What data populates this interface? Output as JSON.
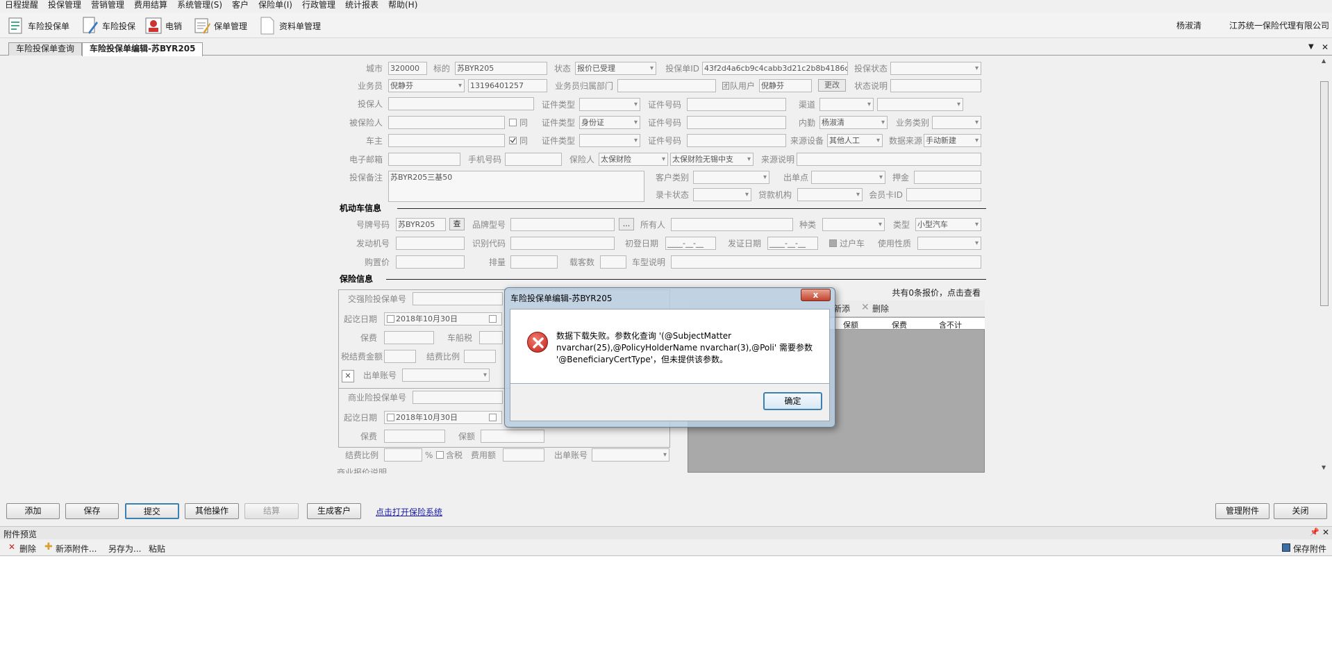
{
  "menu": [
    "日程提醒",
    "投保管理",
    "营销管理",
    "费用结算",
    "系统管理(S)",
    "客户",
    "保险单(I)",
    "行政管理",
    "统计报表",
    "帮助(H)"
  ],
  "toolbar": {
    "buttons": [
      "车险投保单",
      "车险投保",
      "电销",
      "保单管理",
      "资料单管理"
    ],
    "user": "杨淑清",
    "company": "江苏统一保险代理有限公司"
  },
  "tabs": [
    "车险投保单查询",
    "车险投保单编辑-苏BYR205"
  ],
  "form": {
    "labels": {
      "city": "城市",
      "subject": "标的",
      "status": "状态",
      "appid": "投保单ID",
      "appstatus": "投保状态",
      "agent": "业务员",
      "agentdept": "业务员归属部门",
      "teamuser": "团队用户",
      "statusnote": "状态说明",
      "applicant": "投保人",
      "idtype": "证件类型",
      "idno": "证件号码",
      "channel": "渠道",
      "insured": "被保险人",
      "same": "同",
      "internal": "内勤",
      "biztype": "业务类别",
      "owner": "车主",
      "srcdev": "来源设备",
      "datasrc": "数据来源",
      "email": "电子邮箱",
      "mobile": "手机号码",
      "insurer": "保险人",
      "srcnote": "来源说明",
      "remark": "投保备注",
      "custtype": "客户类别",
      "outpoint": "出单点",
      "deposit": "押金",
      "cardstatus": "录卡状态",
      "loanorg": "贷款机构",
      "memberid": "会员卡ID"
    },
    "values": {
      "city": "320000",
      "subject": "苏BYR205",
      "status": "报价已受理",
      "appid": "43f2d4a6cb9c4cabb3d21c2b8b4186d5",
      "agent": "倪静芬",
      "agentphone": "13196401257",
      "teamuser": "倪静芬",
      "change": "更改",
      "insured_idtype": "身份证",
      "internal": "杨淑清",
      "srcdev": "其他人工",
      "datasrc": "手动新建",
      "insurer": "太保财险",
      "insurer_branch": "太保财险无锡中支",
      "remark": "苏BYR205三基50"
    }
  },
  "vehicle": {
    "title": "机动车信息",
    "labels": {
      "plate": "号牌号码",
      "brand": "品牌型号",
      "owner": "所有人",
      "kind": "种类",
      "type": "类型",
      "engine": "发动机号",
      "vin": "识别代码",
      "reg": "初登日期",
      "certdate": "发证日期",
      "transfer": "过户车",
      "usage": "使用性质",
      "price": "购置价",
      "displacement": "排量",
      "seats": "载客数",
      "model": "车型说明"
    },
    "values": {
      "plate": "苏BYR205",
      "query": "查",
      "dots": "...",
      "type": "小型汽车",
      "date_mask": "____-__-__"
    }
  },
  "insurance": {
    "title": "保险信息",
    "labels": {
      "compul_no": "交强险投保单号",
      "period": "起讫日期",
      "premium": "保费",
      "vtax": "车船税",
      "taxamt": "税结费金额",
      "rate": "结费比例",
      "pct": "%",
      "outacct": "出单账号",
      "comm_no": "商业险投保单号",
      "amount": "保额",
      "taxincl": "含税",
      "fee": "费用额",
      "comm_note": "商业报价说明"
    },
    "values": {
      "date": "2018年10月30日"
    },
    "quote": {
      "summary": "共有0条报价，点击查看",
      "new": "新添",
      "delete": "删除",
      "cols": [
        "保额",
        "保费",
        "含不计"
      ]
    }
  },
  "buttons": {
    "add": "添加",
    "save": "保存",
    "submit": "提交",
    "other": "其他操作",
    "settle": "结算",
    "gencust": "生成客户",
    "open_link": "点击打开保险系统",
    "attach": "管理附件",
    "close": "关闭"
  },
  "attachments": {
    "title": "附件预览",
    "pin": "📌",
    "x": "✕",
    "delete": "删除",
    "add": "新添附件...",
    "saveas": "另存为...",
    "paste": "粘贴",
    "save": "保存附件"
  },
  "dialog": {
    "title": "车险投保单编辑-苏BYR205",
    "close": "x",
    "message": "数据下载失败。参数化查询 '(@SubjectMatter nvarchar(25),@PolicyHolderName nvarchar(3),@Poli' 需要参数 '@BeneficiaryCertType'，但未提供该参数。",
    "ok": "确定"
  }
}
